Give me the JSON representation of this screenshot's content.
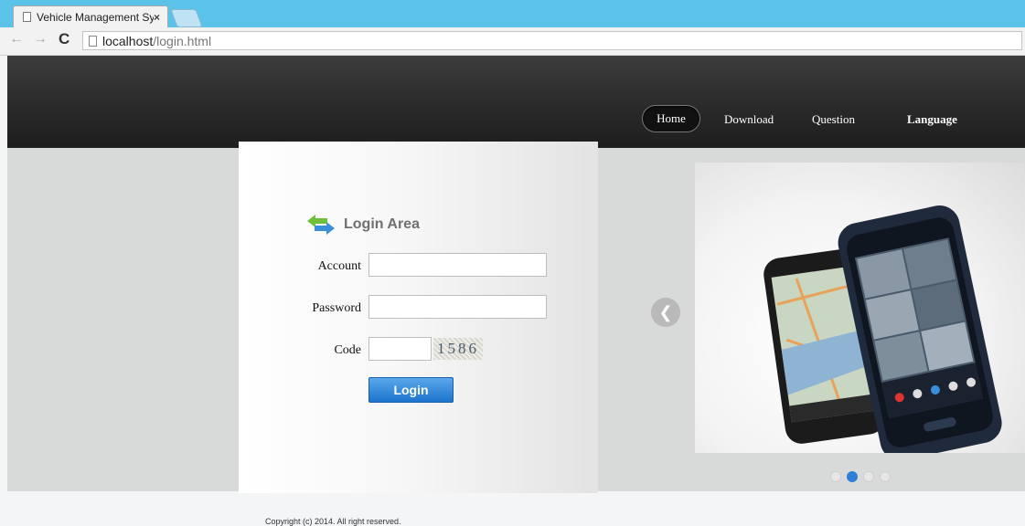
{
  "browser": {
    "tab_title": "Vehicle Management Syst",
    "tab_close": "×",
    "url_host": "localhost",
    "url_path": "/login.html"
  },
  "nav": {
    "home": "Home",
    "download": "Download",
    "question": "Question",
    "language": "Language"
  },
  "login": {
    "title": "Login Area",
    "account_label": "Account",
    "password_label": "Password",
    "code_label": "Code",
    "account_value": "",
    "password_value": "",
    "code_value": "",
    "captcha": "1586",
    "button": "Login"
  },
  "carousel": {
    "prev_icon": "chevron-left-icon",
    "slide_count": 4,
    "active_slide": 2
  },
  "footer": {
    "copyright": "Copyright (c) 2014. All right reserved."
  },
  "colors": {
    "tabstrip": "#5bc2ea",
    "header": "#2a2a2a",
    "login_button": "#2a7fd6",
    "active_dot": "#2f7fd6"
  }
}
